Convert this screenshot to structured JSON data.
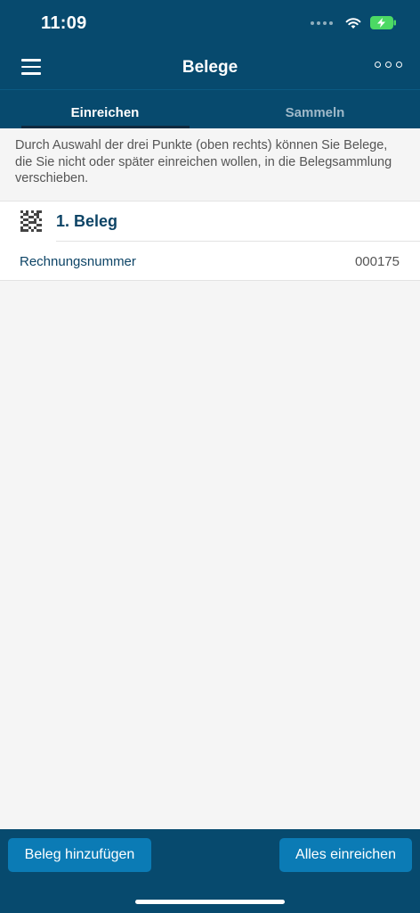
{
  "status": {
    "time": "11:09"
  },
  "header": {
    "title": "Belege",
    "menu_icon": "hamburger-icon",
    "more_icon": "more-dots-icon"
  },
  "tabs": [
    {
      "label": "Einreichen",
      "active": true
    },
    {
      "label": "Sammeln",
      "active": false
    }
  ],
  "info": {
    "text": "Durch Auswahl der drei Punkte (oben rechts) können Sie Belege, die Sie nicht oder später einreichen wollen, in die Belegsammlung verschieben."
  },
  "beleg": {
    "title": "1. Beleg",
    "icon": "qr-code-icon",
    "field_label": "Rechnungsnummer",
    "field_value": "000175"
  },
  "actions": {
    "add_label": "Beleg hinzufügen",
    "submit_all_label": "Alles einreichen"
  },
  "colors": {
    "primary": "#074a6e",
    "button": "#0b7bb5",
    "accent_text": "#0d4466",
    "battery": "#4cd964"
  }
}
